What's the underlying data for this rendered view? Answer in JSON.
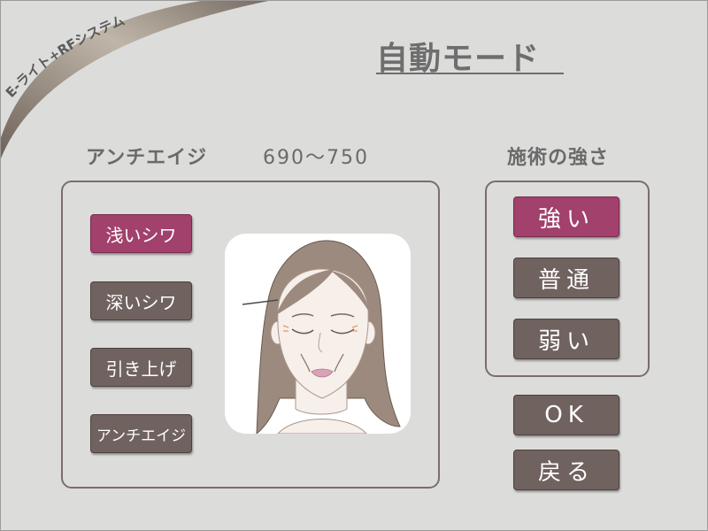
{
  "brand": {
    "text": "E-ライト+RFシステム"
  },
  "page": {
    "title": "自動モード"
  },
  "mode": {
    "heading": "アンチエイジ",
    "range": "690〜750",
    "buttons": [
      {
        "label": "浅いシワ",
        "selected": true
      },
      {
        "label": "深いシワ",
        "selected": false
      },
      {
        "label": "引き上げ",
        "selected": false
      },
      {
        "label": "アンチエイジ",
        "selected": false
      }
    ]
  },
  "strength": {
    "heading": "施術の強さ",
    "buttons": [
      {
        "label": "強い",
        "selected": true
      },
      {
        "label": "普通",
        "selected": false
      },
      {
        "label": "弱い",
        "selected": false
      }
    ]
  },
  "actions": {
    "ok_label": "OK",
    "back_label": "戻る"
  },
  "colors": {
    "background": "#dcdcdb",
    "button": "#6f625f",
    "selected_button": "#a2416c",
    "text_gray": "#6a6a6a",
    "panel_border": "#7a6e6a"
  },
  "icons": {
    "face": "face-illustration"
  }
}
